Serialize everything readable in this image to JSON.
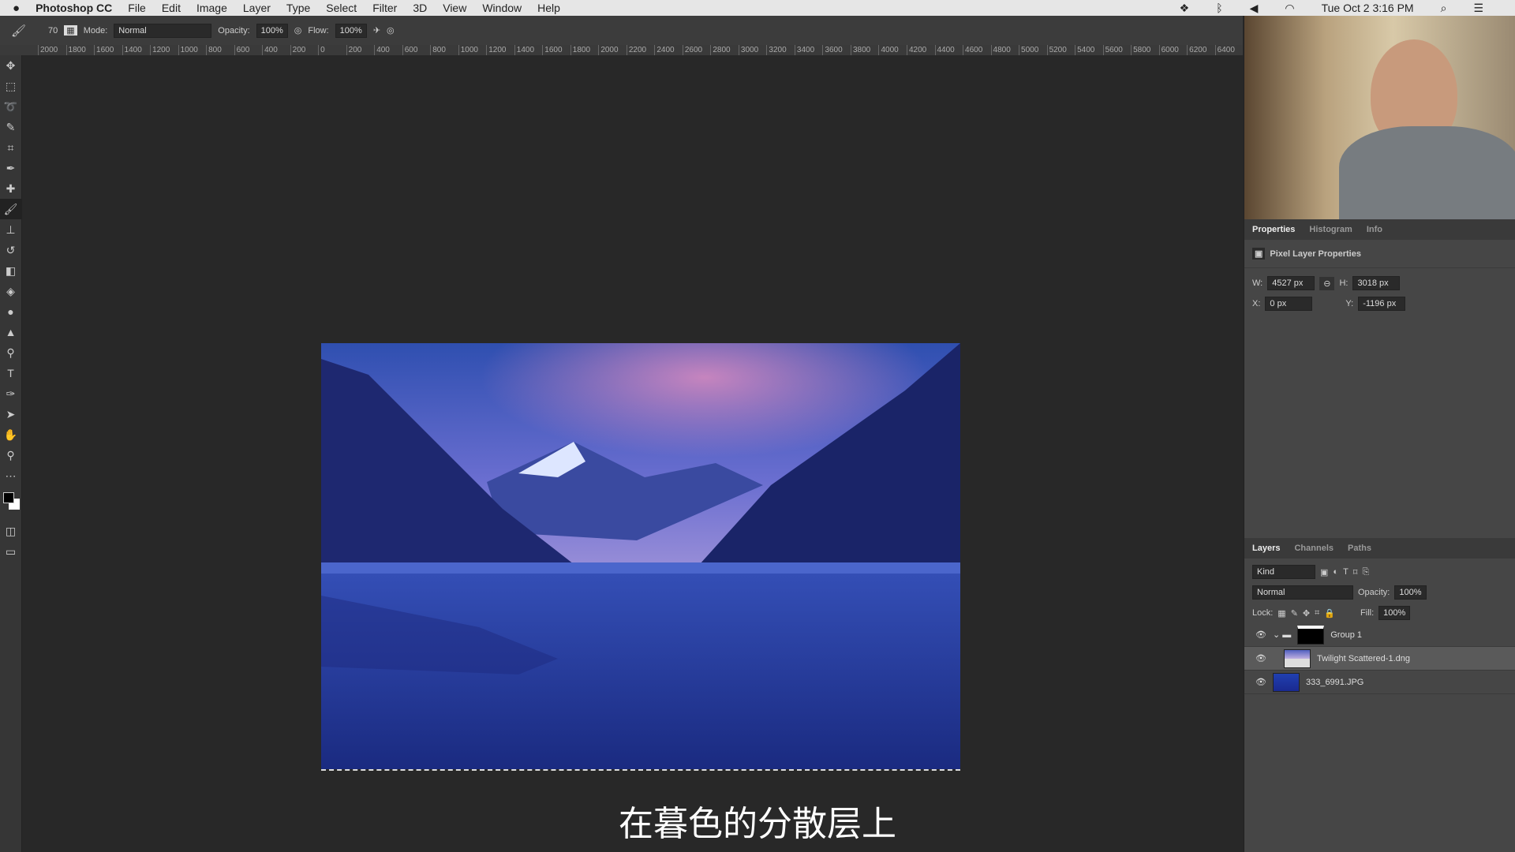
{
  "menubar": {
    "app": "Photoshop CC",
    "items": [
      "File",
      "Edit",
      "Image",
      "Layer",
      "Type",
      "Select",
      "Filter",
      "3D",
      "View",
      "Window",
      "Help"
    ],
    "clock": "Tue Oct 2  3:16 PM"
  },
  "options": {
    "brush_size": "70",
    "mode_label": "Mode:",
    "mode": "Normal",
    "opacity_label": "Opacity:",
    "opacity": "100%",
    "flow_label": "Flow:",
    "flow": "100%"
  },
  "ruler": [
    "2000",
    "1800",
    "1600",
    "1400",
    "1200",
    "1000",
    "800",
    "600",
    "400",
    "200",
    "0",
    "200",
    "400",
    "600",
    "800",
    "1000",
    "1200",
    "1400",
    "1600",
    "1800",
    "2000",
    "2200",
    "2400",
    "2600",
    "2800",
    "3000",
    "3200",
    "3400",
    "3600",
    "3800",
    "4000",
    "4200",
    "4400",
    "4600",
    "4800",
    "5000",
    "5200",
    "5400",
    "5600",
    "5800",
    "6000",
    "6200",
    "6400"
  ],
  "properties": {
    "tabs": [
      "Properties",
      "Histogram",
      "Info"
    ],
    "title": "Pixel Layer Properties",
    "w_label": "W:",
    "w": "4527 px",
    "h_label": "H:",
    "h": "3018 px",
    "x_label": "X:",
    "x": "0 px",
    "y_label": "Y:",
    "y": "-1196 px"
  },
  "layers": {
    "tabs": [
      "Layers",
      "Channels",
      "Paths"
    ],
    "filter": "Kind",
    "blend": "Normal",
    "opacity_label": "Opacity:",
    "opacity": "100%",
    "lock_label": "Lock:",
    "fill_label": "Fill:",
    "fill": "100%",
    "items": [
      {
        "name": "Group 1"
      },
      {
        "name": "Twilight Scattered-1.dng"
      },
      {
        "name": "333_6991.JPG"
      }
    ]
  },
  "subtitle": "在暮色的分散层上"
}
